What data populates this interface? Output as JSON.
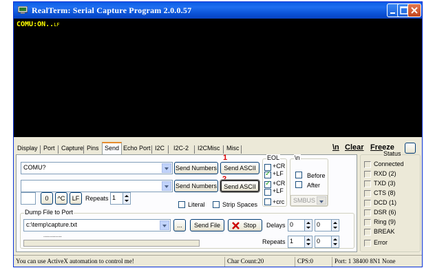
{
  "window": {
    "title": "RealTerm: Serial Capture Program 2.0.0.57"
  },
  "terminal": {
    "text": "COMU:ON..",
    "line_end_glyph": "LF"
  },
  "tabs": [
    {
      "label": "Display"
    },
    {
      "label": "Port"
    },
    {
      "label": "Capture"
    },
    {
      "label": "Pins"
    },
    {
      "label": "Send",
      "active": true
    },
    {
      "label": "Echo Port"
    },
    {
      "label": "I2C"
    },
    {
      "label": "I2C-2"
    },
    {
      "label": "I2CMisc"
    },
    {
      "label": "Misc"
    }
  ],
  "toolbar": {
    "newline_label": "\\n",
    "clear_label": "Clear",
    "freeze_label": "Freeze"
  },
  "send": {
    "row1": {
      "value": "COMU?",
      "send_numbers": "Send Numbers",
      "send_ascii": "Send ASCII",
      "marker": "1"
    },
    "row2": {
      "value": "",
      "send_numbers": "Send Numbers",
      "send_ascii": "Send ASCII",
      "marker": "2"
    },
    "zero_btn": "0",
    "ctrl_c_btn": "^C",
    "lf_btn": "LF",
    "repeats_label": "Repeats",
    "repeats_value": "1",
    "literal_label": "Literal",
    "strip_spaces_label": "Strip Spaces",
    "eol": {
      "title": "EOL",
      "cr1": "+CR",
      "lf1": "+LF",
      "cr2": "+CR",
      "lf2": "+LF",
      "crc": "+crc",
      "cr1_checked": false,
      "lf1_checked": true,
      "cr2_checked": true,
      "lf2_checked": false,
      "crc_checked": false
    },
    "newline_group": {
      "title": "\\n",
      "before": "Before",
      "after": "After",
      "smbus_value": "SMBUS 8"
    }
  },
  "dump": {
    "title": "Dump File to Port",
    "file_value": "c:\\temp\\capture.txt",
    "browse_label": "...",
    "send_file_label": "Send File",
    "stop_label": "Stop",
    "delays_label": "Delays",
    "delay1": "0",
    "delay2": "0",
    "repeats_label": "Repeats",
    "repeats1": "1",
    "repeats2": "0",
    "dashes": "............"
  },
  "status": {
    "title": "Status",
    "items": [
      "Connected",
      "RXD (2)",
      "TXD (3)",
      "CTS (8)",
      "DCD (1)",
      "DSR (6)",
      "Ring (9)",
      "BREAK",
      "Error"
    ]
  },
  "statusbar": {
    "message": "You can use ActiveX automation to control me!",
    "char_count": "Char Count:20",
    "cps": "CPS:0",
    "port": "Port: 1 38400 8N1 None"
  },
  "colors": {
    "title_blue": "#0a5ce4",
    "terminal_bg": "#000000",
    "terminal_text": "#ffff00",
    "marker_red": "#e00000",
    "stop_x": "#cc0000"
  }
}
